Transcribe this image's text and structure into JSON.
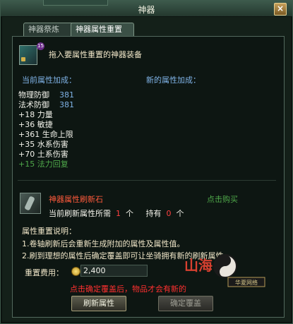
{
  "window": {
    "title": "神器",
    "close_label": "×"
  },
  "tabs": [
    {
      "label": "神器祭炼"
    },
    {
      "label": "神器属性重置"
    }
  ],
  "equipment_slot": {
    "level_badge": "15",
    "hint": "拖入要属性重置的神器装备"
  },
  "current_attrs": {
    "header": "当前属性加成：",
    "items": [
      {
        "name": "物理防御",
        "value": "381"
      },
      {
        "name": "法术防御",
        "value": "381"
      }
    ],
    "bonuses": [
      "+18 力量",
      "+36 敏捷",
      "+361 生命上限",
      "+35 水系伤害",
      "+70 土系伤害"
    ],
    "special": "+15 法力回复"
  },
  "new_attrs": {
    "header": "新的属性加成："
  },
  "reset_stone": {
    "name": "神器属性刷新石",
    "buy_link": "点击购买",
    "need_label": "当前刷新属性所需",
    "need_count": "1",
    "unit": "个",
    "own_label": "持有",
    "own_count": "0",
    "own_unit": "个"
  },
  "notes": {
    "title": "属性重置说明：",
    "lines": [
      "1.卷轴刷新后会重新生成附加的属性及属性值。",
      "2.刷到理想的属性后确定覆盖即可让坐骑拥有新的刷新属性。"
    ]
  },
  "cost": {
    "label": "重置费用：",
    "value": "2,400"
  },
  "warning": "点击确定覆盖后，物品才会有新的",
  "buttons": {
    "refresh": "刷新属性",
    "confirm": "确定覆盖"
  },
  "logo": {
    "text": "山海",
    "subtitle": "华夏网络"
  }
}
